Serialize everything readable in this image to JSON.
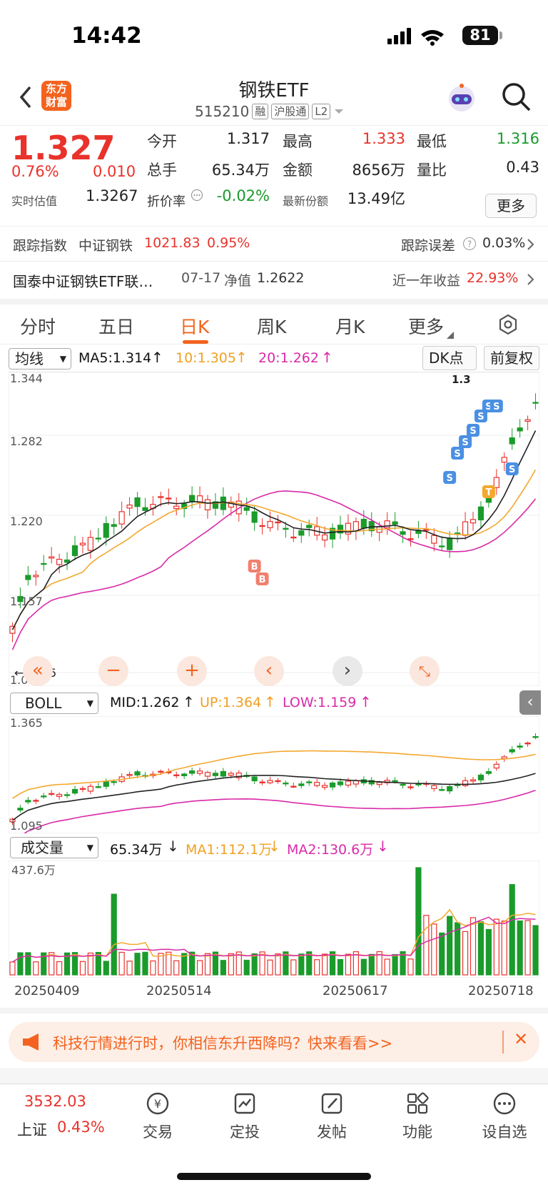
{
  "status": {
    "time": "14:42",
    "battery": "81"
  },
  "header": {
    "title": "钢铁ETF",
    "code": "515210",
    "tags": [
      "融",
      "沪股通",
      "L2"
    ],
    "logo": "东方财富"
  },
  "quote": {
    "price": "1.327",
    "pct": "0.76%",
    "chg": "0.010",
    "open_k": "今开",
    "open_v": "1.317",
    "high_k": "最高",
    "high_v": "1.333",
    "low_k": "最低",
    "low_v": "1.316",
    "vol_k": "总手",
    "vol_v": "65.34万",
    "amt_k": "金额",
    "amt_v": "8656万",
    "ratio_k": "量比",
    "ratio_v": "0.43",
    "est_k": "实时估值",
    "est_v": "1.3267",
    "prem_k": "折价率",
    "prem_v": "-0.02%",
    "share_k": "最新份额",
    "share_v": "13.49亿",
    "more": "更多"
  },
  "track": {
    "label": "跟踪指数",
    "index": "中证钢铁",
    "value": "1021.83",
    "pct": "0.95%",
    "err_k": "跟踪误差",
    "err_v": "0.03%"
  },
  "fund": {
    "name": "国泰中证钢铁ETF联…",
    "nav_date": "07-17",
    "nav_k": "净值",
    "nav_v": "1.2622",
    "ret_k": "近一年收益",
    "ret_v": "22.93%"
  },
  "tabs": [
    "分时",
    "五日",
    "日K",
    "周K",
    "月K",
    "更多"
  ],
  "ma": {
    "select": "均线",
    "ma5": "MA5:1.314",
    "ma10": "10:1.305",
    "ma20": "20:1.262",
    "dk": "DK点",
    "fq": "前复权"
  },
  "boll": {
    "select": "BOLL",
    "mid": "MID:1.262",
    "up": "UP:1.364",
    "low": "LOW:1.159"
  },
  "vol": {
    "select": "成交量",
    "v": "65.34万",
    "ma1": "MA1:112.1万",
    "ma2": "MA2:130.6万",
    "max": "437.6万"
  },
  "chart_data": {
    "type": "candlestick",
    "ylim": [
      1.095,
      1.344
    ],
    "yticks": [
      "1.344",
      "1.282",
      "1.220",
      "1.157",
      "1.095"
    ],
    "boll_ylim": [
      1.095,
      1.365
    ],
    "boll_ticks": [
      "1.365",
      "1.095"
    ],
    "dates": [
      "20250409",
      "20250514",
      "20250617",
      "20250718"
    ],
    "callout": "1.3",
    "low_label": "←1.095",
    "buy": "B",
    "sell": "S",
    "t": "T"
  },
  "banner": {
    "text": "科技行情进行时，你相信东升西降吗？快来看看>>"
  },
  "bottom": {
    "index_v": "3532.03",
    "index_k": "上证",
    "index_pct": "0.43%",
    "items": [
      "交易",
      "定投",
      "发帖",
      "功能",
      "设自选"
    ]
  }
}
